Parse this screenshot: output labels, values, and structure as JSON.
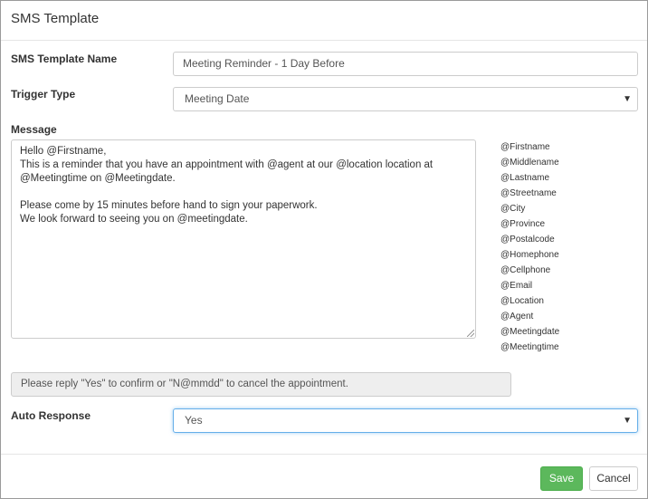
{
  "dialog": {
    "title": "SMS Template"
  },
  "form": {
    "template_name": {
      "label": "SMS Template Name",
      "value": "Meeting Reminder - 1 Day Before"
    },
    "trigger_type": {
      "label": "Trigger Type",
      "selected": "Meeting Date"
    },
    "message": {
      "label": "Message",
      "lines": [
        "Hello @Firstname,",
        "This is a reminder that you have an appointment with @agent at our @location location at",
        "@Meetingtime on @Meetingdate.",
        "",
        "Please come by 15 minutes before hand to sign your paperwork.",
        "We look forward to seeing you on @meetingdate."
      ]
    },
    "placeholders": [
      "@Firstname",
      "@Middlename",
      "@Lastname",
      "@Streetname",
      "@City",
      "@Province",
      "@Postalcode",
      "@Homephone",
      "@Cellphone",
      "@Email",
      "@Location",
      "@Agent",
      "@Meetingdate",
      "@Meetingtime"
    ],
    "reply_instructions": "Please reply \"Yes\" to confirm or \"N@mmdd\" to cancel the appointment.",
    "auto_response": {
      "label": "Auto Response",
      "selected": "Yes"
    }
  },
  "footer": {
    "save_label": "Save",
    "cancel_label": "Cancel"
  },
  "colors": {
    "save_button": "#5cb85c",
    "focus_border": "#66afe9"
  },
  "icons": {
    "dropdown": "chevron-down-icon",
    "resize": "resize-grip-icon"
  }
}
